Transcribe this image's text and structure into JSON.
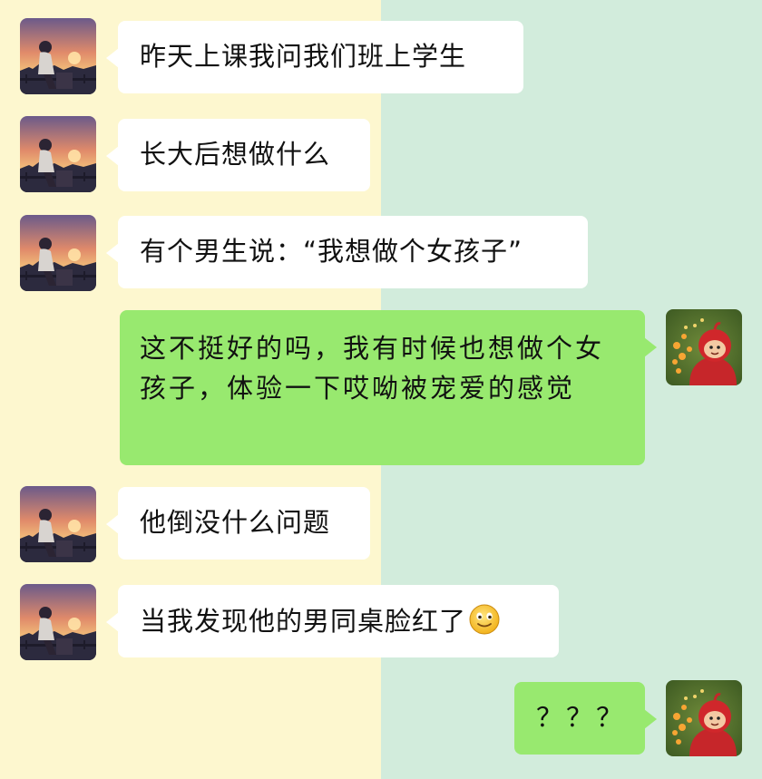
{
  "chat": {
    "messages": [
      {
        "side": "left",
        "avatar": "sunset-boy-avatar",
        "text": "昨天上课我问我们班上学生"
      },
      {
        "side": "left",
        "avatar": "sunset-boy-avatar",
        "text": "长大后想做什么"
      },
      {
        "side": "left",
        "avatar": "sunset-boy-avatar",
        "text": "有个男生说：“我想做个女孩子”"
      },
      {
        "side": "right",
        "avatar": "teletubby-avatar",
        "text": "这不挺好的吗，我有时候也想做个女孩子，体验一下哎呦被宠爱的感觉"
      },
      {
        "side": "left",
        "avatar": "sunset-boy-avatar",
        "text": "他倒没什么问题"
      },
      {
        "side": "left",
        "avatar": "sunset-boy-avatar",
        "text": "当我发现他的男同桌脸红了",
        "emoji": "smiley-emoji-icon"
      },
      {
        "side": "right",
        "avatar": "teletubby-avatar",
        "text": "？？？"
      }
    ]
  },
  "colors": {
    "left_panel_bg": "#fdf7cf",
    "right_panel_bg": "#d2ecdc",
    "incoming_bubble": "#ffffff",
    "outgoing_bubble": "#98e96f"
  }
}
